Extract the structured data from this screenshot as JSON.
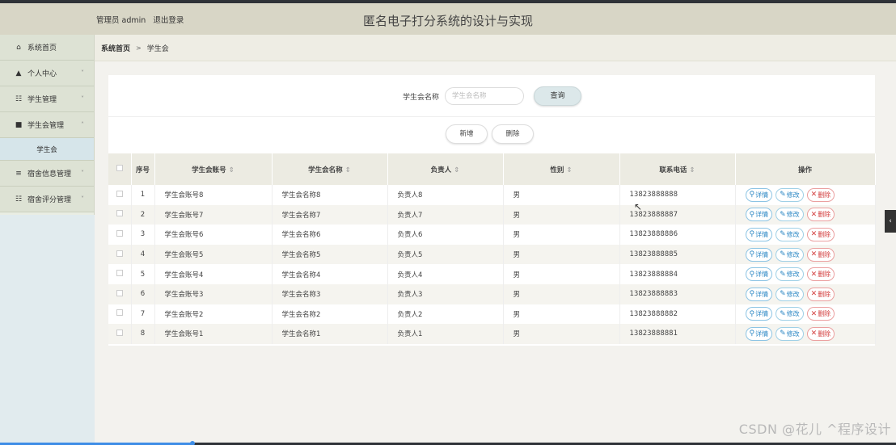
{
  "header": {
    "user_label": "管理员 admin",
    "logout_label": "退出登录",
    "title": "匿名电子打分系统的设计与实现"
  },
  "sidebar": {
    "items": [
      {
        "label": "系统首页",
        "icon": "home-icon",
        "glyph": "⌂",
        "arrow": ""
      },
      {
        "label": "个人中心",
        "icon": "user-icon",
        "glyph": "▲",
        "arrow": "˅"
      },
      {
        "label": "学生管理",
        "icon": "grid-icon",
        "glyph": "☷",
        "arrow": "˅"
      },
      {
        "label": "学生会管理",
        "icon": "book-icon",
        "glyph": "■",
        "arrow": "˄"
      },
      {
        "label": "宿舍信息管理",
        "icon": "list-icon",
        "glyph": "≡",
        "arrow": "˅"
      },
      {
        "label": "宿舍评分管理",
        "icon": "grid-icon",
        "glyph": "☷",
        "arrow": "˅"
      }
    ],
    "sub_item": "学生会"
  },
  "breadcrumb": {
    "home": "系统首页",
    "separator": ">",
    "current": "学生会"
  },
  "search": {
    "label": "学生会名称",
    "placeholder": "学生会名称",
    "button": "查询"
  },
  "actions": {
    "add": "新增",
    "delete": "删除"
  },
  "table": {
    "headers": {
      "index": "序号",
      "account": "学生会账号",
      "name": "学生会名称",
      "leader": "负责人",
      "gender": "性别",
      "phone": "联系电话",
      "ops": "操作"
    },
    "sort_glyph": "⇕",
    "rows": [
      {
        "idx": "1",
        "account": "学生会账号8",
        "name": "学生会名称8",
        "leader": "负责人8",
        "gender": "男",
        "phone": "13823888888"
      },
      {
        "idx": "2",
        "account": "学生会账号7",
        "name": "学生会名称7",
        "leader": "负责人7",
        "gender": "男",
        "phone": "13823888887"
      },
      {
        "idx": "3",
        "account": "学生会账号6",
        "name": "学生会名称6",
        "leader": "负责人6",
        "gender": "男",
        "phone": "13823888886"
      },
      {
        "idx": "4",
        "account": "学生会账号5",
        "name": "学生会名称5",
        "leader": "负责人5",
        "gender": "男",
        "phone": "13823888885"
      },
      {
        "idx": "5",
        "account": "学生会账号4",
        "name": "学生会名称4",
        "leader": "负责人4",
        "gender": "男",
        "phone": "13823888884"
      },
      {
        "idx": "6",
        "account": "学生会账号3",
        "name": "学生会名称3",
        "leader": "负责人3",
        "gender": "男",
        "phone": "13823888883"
      },
      {
        "idx": "7",
        "account": "学生会账号2",
        "name": "学生会名称2",
        "leader": "负责人2",
        "gender": "男",
        "phone": "13823888882"
      },
      {
        "idx": "8",
        "account": "学生会账号1",
        "name": "学生会名称1",
        "leader": "负责人1",
        "gender": "男",
        "phone": "13823888881"
      }
    ],
    "op_labels": {
      "detail": "详情",
      "edit": "修改",
      "delete": "删除"
    },
    "op_glyphs": {
      "detail": "⚲",
      "edit": "✎",
      "delete": "✕"
    }
  },
  "side_tab_glyph": "‹",
  "watermark": "CSDN @花儿 ^程序设计",
  "progress_fraction": 0.215,
  "colors": {
    "header_bg": "#d8d6c6",
    "accent_blue": "#2b87c4",
    "danger_red": "#d23c3c"
  }
}
